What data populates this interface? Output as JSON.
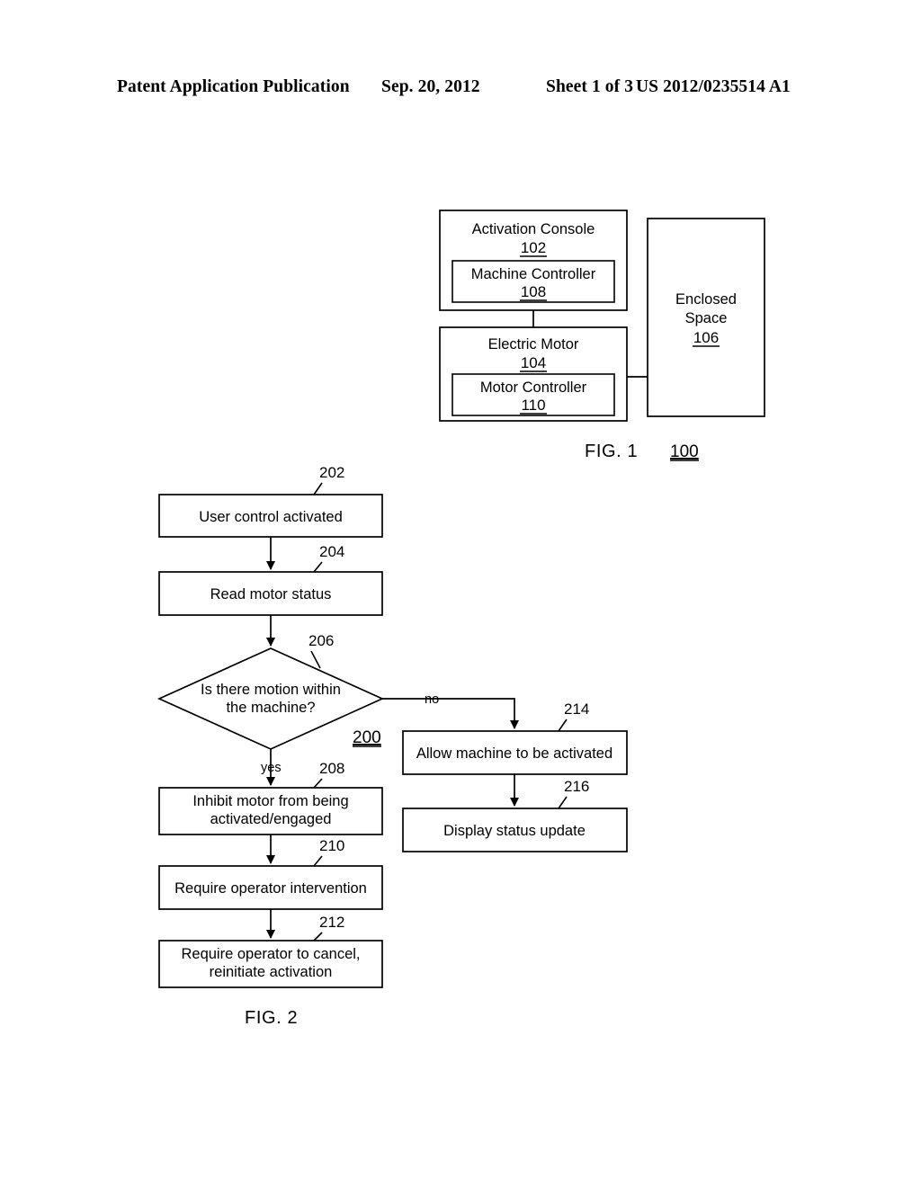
{
  "header": {
    "publication": "Patent Application Publication",
    "date": "Sep. 20, 2012",
    "sheet": "Sheet 1 of 3",
    "patent_number": "US 2012/0235514 A1"
  },
  "figure1": {
    "caption": "FIG. 1",
    "caption_ref": "100",
    "blocks": {
      "activation_console": {
        "label": "Activation Console",
        "ref": "102"
      },
      "machine_controller": {
        "label": "Machine Controller",
        "ref": "108"
      },
      "electric_motor": {
        "label": "Electric Motor",
        "ref": "104"
      },
      "motor_controller": {
        "label": "Motor Controller",
        "ref": "110"
      },
      "enclosed_space": {
        "label_line1": "Enclosed",
        "label_line2": "Space",
        "ref": "106"
      }
    }
  },
  "figure2": {
    "caption": "FIG. 2",
    "caption_ref": "200",
    "branch_yes": "yes",
    "branch_no": "no",
    "steps": [
      {
        "ref": "202",
        "label_line1": "User control activated",
        "label_line2": ""
      },
      {
        "ref": "204",
        "label_line1": "Read motor status",
        "label_line2": ""
      },
      {
        "ref": "206",
        "label_line1": "Is there motion within",
        "label_line2": "the machine?"
      },
      {
        "ref": "208",
        "label_line1": "Inhibit motor from being",
        "label_line2": "activated/engaged"
      },
      {
        "ref": "210",
        "label_line1": "Require operator intervention",
        "label_line2": ""
      },
      {
        "ref": "212",
        "label_line1": "Require operator to cancel,",
        "label_line2": "reinitiate activation"
      },
      {
        "ref": "214",
        "label_line1": "Allow machine to be activated",
        "label_line2": ""
      },
      {
        "ref": "216",
        "label_line1": "Display status update",
        "label_line2": ""
      }
    ]
  },
  "colors": {
    "ink": "#000000",
    "paper": "#ffffff"
  }
}
